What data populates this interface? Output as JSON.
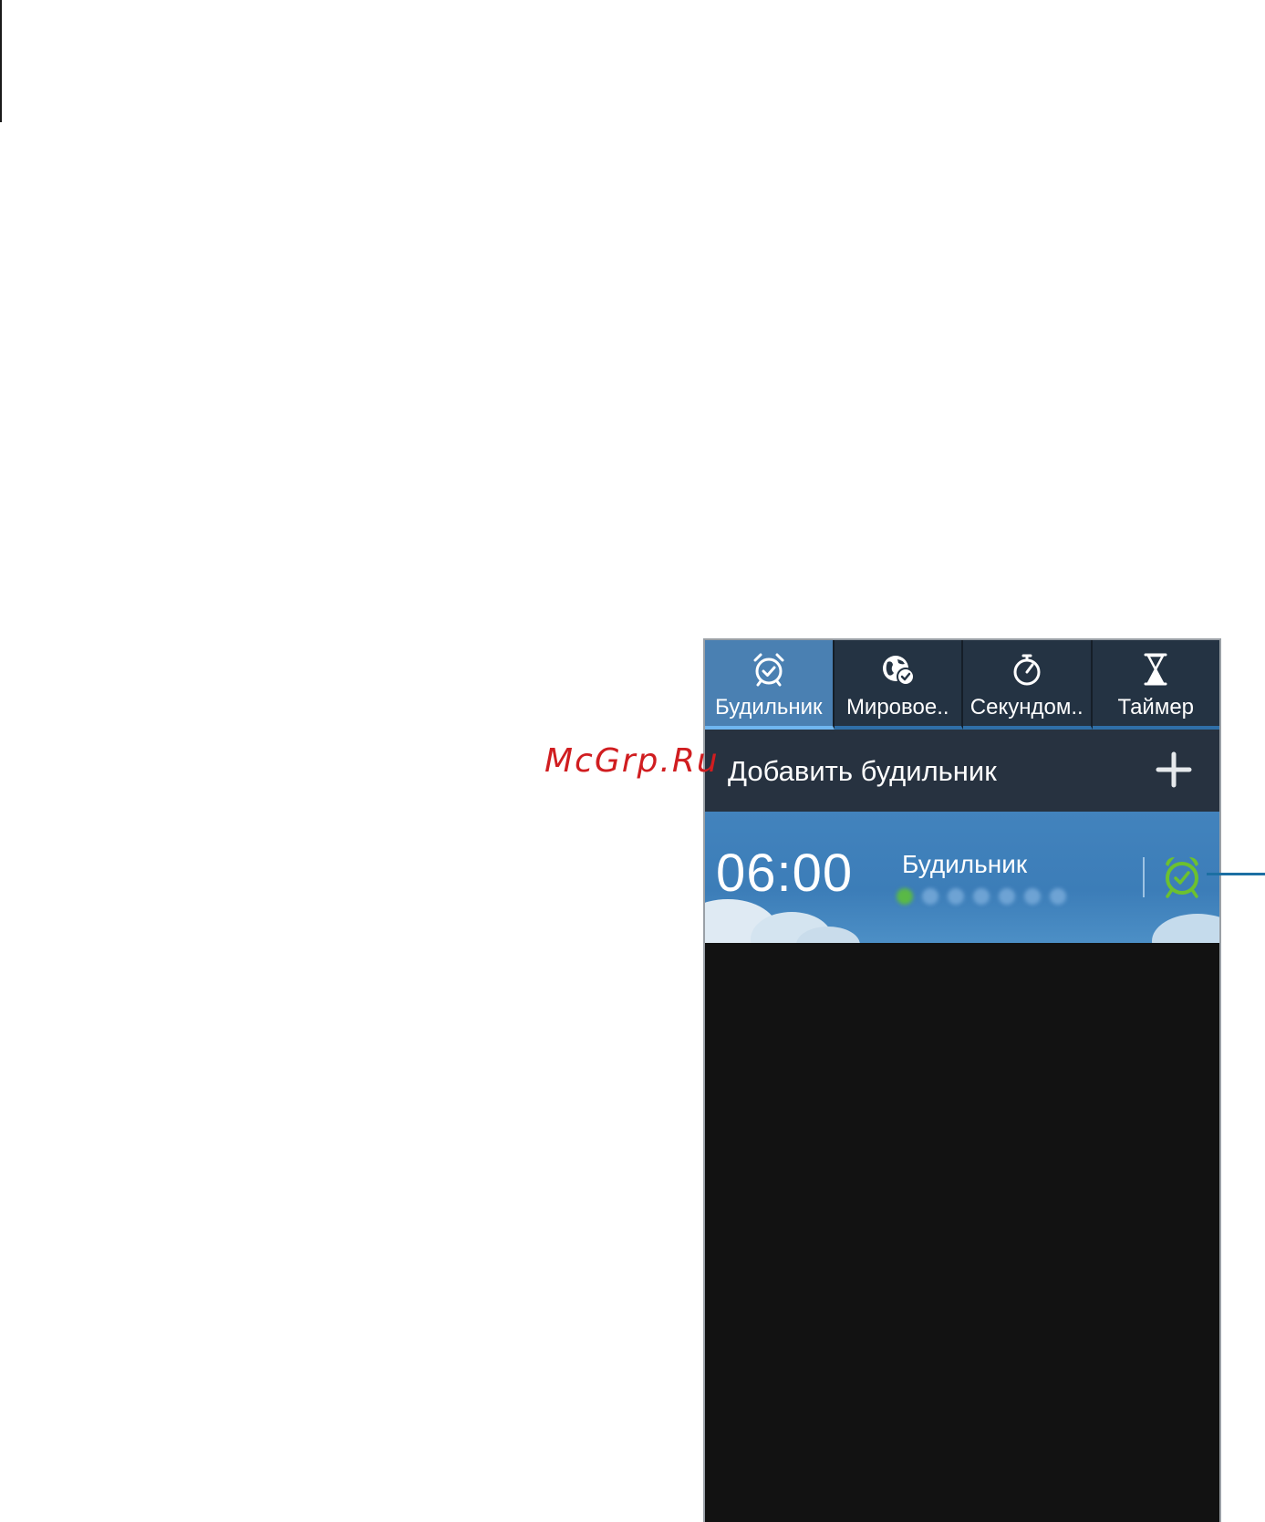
{
  "watermark": "McGrp.Ru",
  "tabs": [
    {
      "label": "Будильник",
      "icon": "alarm-clock-icon",
      "active": true
    },
    {
      "label": "Мировое..",
      "icon": "world-clock-icon",
      "active": false
    },
    {
      "label": "Секундом..",
      "icon": "stopwatch-icon",
      "active": false
    },
    {
      "label": "Таймер",
      "icon": "hourglass-icon",
      "active": false
    }
  ],
  "add_alarm": {
    "label": "Добавить будильник",
    "icon": "plus-icon"
  },
  "alarm": {
    "time": "06:00",
    "name": "Будильник",
    "enabled": true,
    "icon": "alarm-active-icon",
    "icon_color": "#6cc12f"
  },
  "colors": {
    "active_tab": "#4a80b2",
    "tab_bar": "#243343",
    "alarm_row": "#3f80ba",
    "screen_bg": "#121212"
  }
}
